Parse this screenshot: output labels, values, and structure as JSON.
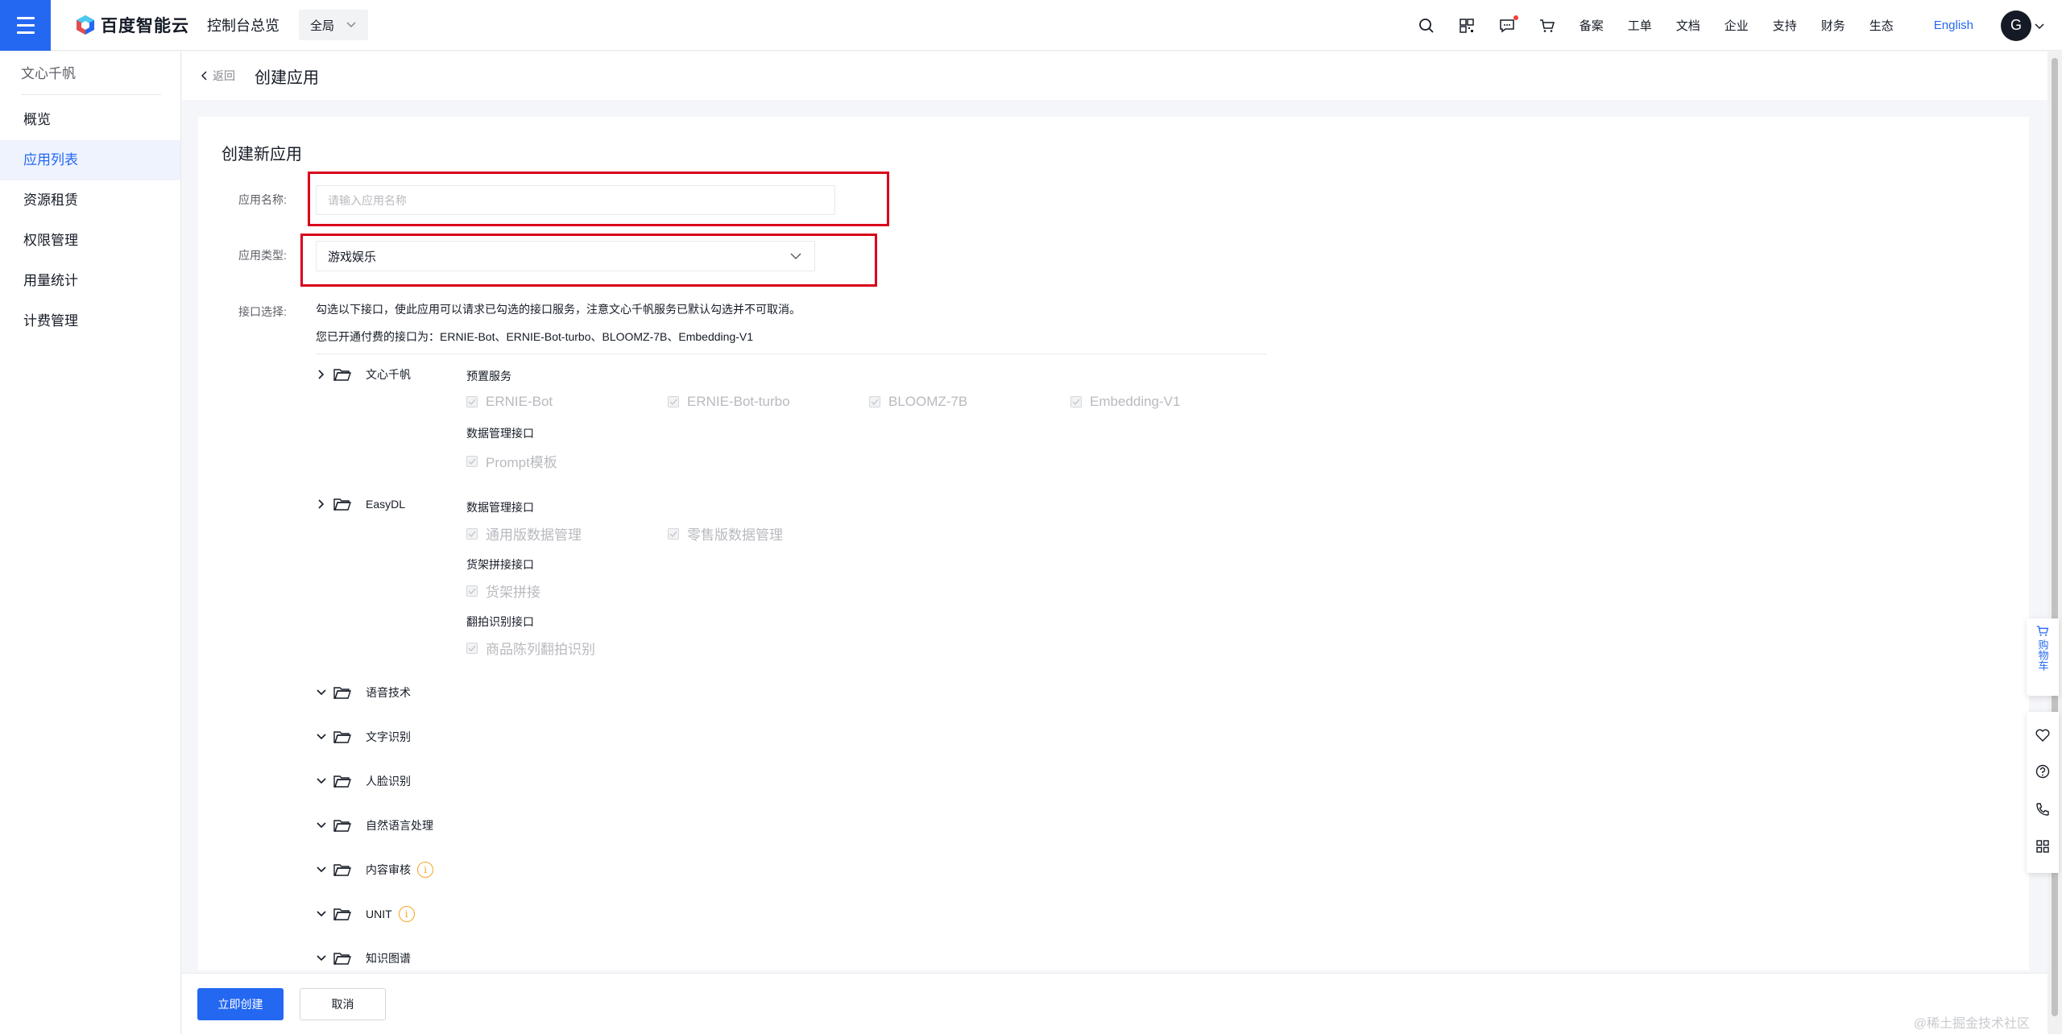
{
  "header": {
    "logo_text": "百度智能云",
    "console_title": "控制台总览",
    "region": "全局",
    "nav": [
      "备案",
      "工单",
      "文档",
      "企业",
      "支持",
      "财务",
      "生态"
    ],
    "lang": "English",
    "avatar": "G"
  },
  "sidebar": {
    "title": "文心千帆",
    "items": [
      "概览",
      "应用列表",
      "资源租赁",
      "权限管理",
      "用量统计",
      "计费管理"
    ],
    "active_index": 1
  },
  "breadcrumb": {
    "back": "返回",
    "title": "创建应用"
  },
  "form": {
    "card_title": "创建新应用",
    "name_label": "应用名称:",
    "name_placeholder": "请输入应用名称",
    "type_label": "应用类型:",
    "type_value": "游戏娱乐",
    "api_label": "接口选择:",
    "hint1": "勾选以下接口，使此应用可以请求已勾选的接口服务，注意文心千帆服务已默认勾选并不可取消。",
    "hint2": "您已开通付费的接口为：ERNIE-Bot、ERNIE-Bot-turbo、BLOOMZ-7B、Embedding-V1"
  },
  "groups": {
    "wenxin": {
      "name": "文心千帆",
      "sub1": "预置服务",
      "sub1_items": [
        "ERNIE-Bot",
        "ERNIE-Bot-turbo",
        "BLOOMZ-7B",
        "Embedding-V1"
      ],
      "sub2": "数据管理接口",
      "sub2_items": [
        "Prompt模板"
      ]
    },
    "easydl": {
      "name": "EasyDL",
      "sub1": "数据管理接口",
      "sub1_items": [
        "通用版数据管理",
        "零售版数据管理"
      ],
      "sub2": "货架拼接接口",
      "sub2_items": [
        "货架拼接"
      ],
      "sub3": "翻拍识别接口",
      "sub3_items": [
        "商品陈列翻拍识别"
      ]
    },
    "collapsed": [
      "语音技术",
      "文字识别",
      "人脸识别",
      "自然语言处理",
      "内容审核",
      "UNIT",
      "知识图谱"
    ]
  },
  "footer": {
    "create": "立即创建",
    "cancel": "取消",
    "watermark": "@稀土掘金技术社区"
  },
  "float": {
    "cart": "购物车"
  },
  "colors": {
    "primary": "#2468f2",
    "highlight_box": "#d9001b",
    "warning": "#f5a623"
  }
}
